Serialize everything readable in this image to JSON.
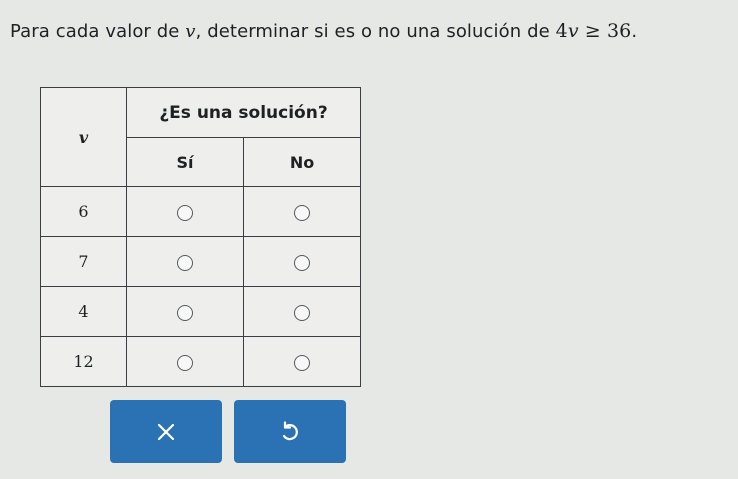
{
  "question": {
    "prefix": "Para cada valor de ",
    "variable": "v",
    "middle": ", determinar si es o no una solución de ",
    "lhs_coef": "4",
    "lhs_var": "v",
    "operator": " ≥ ",
    "rhs": "36",
    "suffix": "."
  },
  "table": {
    "header_variable": "v",
    "header_question": "¿Es una solución?",
    "col_yes": "Sí",
    "col_no": "No",
    "rows": [
      {
        "value": "6"
      },
      {
        "value": "7"
      },
      {
        "value": "4"
      },
      {
        "value": "12"
      }
    ]
  },
  "buttons": {
    "clear_icon": "close-icon",
    "undo_icon": "undo-icon",
    "color": "#2b72b4"
  }
}
